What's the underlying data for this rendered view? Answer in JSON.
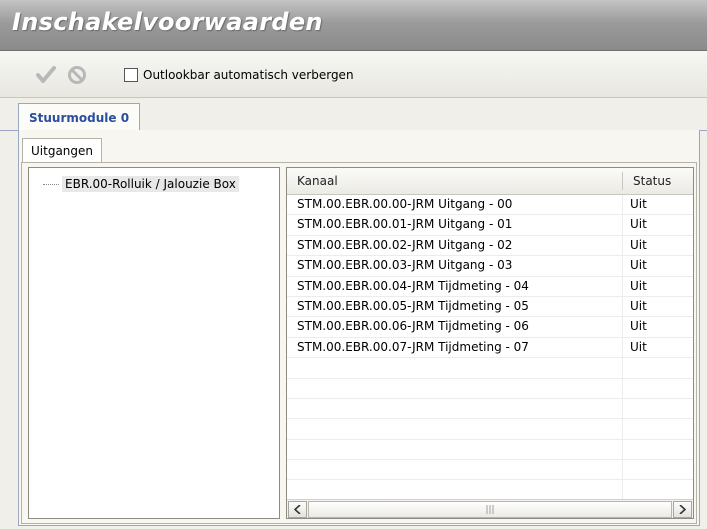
{
  "window": {
    "title": "Inschakelvoorwaarden"
  },
  "toolbar": {
    "confirm_icon": "check-icon",
    "cancel_icon": "cancel-icon",
    "checkbox_label": "Outlookbar automatisch verbergen",
    "checkbox_checked": false
  },
  "main_tab": {
    "label": "Stuurmodule 0"
  },
  "sub_tab": {
    "label": "Uitgangen"
  },
  "tree": {
    "items": [
      {
        "label": "EBR.00-Rolluik / Jalouzie Box"
      }
    ]
  },
  "list": {
    "columns": [
      "Kanaal",
      "Status"
    ],
    "rows": [
      {
        "kanaal": "STM.00.EBR.00.00-JRM Uitgang - 00",
        "status": "Uit"
      },
      {
        "kanaal": "STM.00.EBR.00.01-JRM Uitgang - 01",
        "status": "Uit"
      },
      {
        "kanaal": "STM.00.EBR.00.02-JRM Uitgang - 02",
        "status": "Uit"
      },
      {
        "kanaal": "STM.00.EBR.00.03-JRM Uitgang - 03",
        "status": "Uit"
      },
      {
        "kanaal": "STM.00.EBR.00.04-JRM Tijdmeting - 04",
        "status": "Uit"
      },
      {
        "kanaal": "STM.00.EBR.00.05-JRM Tijdmeting - 05",
        "status": "Uit"
      },
      {
        "kanaal": "STM.00.EBR.00.06-JRM Tijdmeting - 06",
        "status": "Uit"
      },
      {
        "kanaal": "STM.00.EBR.00.07-JRM Tijdmeting - 07",
        "status": "Uit"
      },
      {
        "kanaal": "",
        "status": ""
      },
      {
        "kanaal": "",
        "status": ""
      },
      {
        "kanaal": "",
        "status": ""
      },
      {
        "kanaal": "",
        "status": ""
      },
      {
        "kanaal": "",
        "status": ""
      },
      {
        "kanaal": "",
        "status": ""
      },
      {
        "kanaal": "",
        "status": ""
      }
    ]
  },
  "scrollbar": {
    "left_icon": "chevron-left-icon",
    "right_icon": "chevron-right-icon",
    "grip_icon": "grip-icon"
  },
  "colors": {
    "title_bg": "#9b9b9b",
    "tab_accent": "#2a4da0",
    "check_gray": "#b8b8b8"
  }
}
